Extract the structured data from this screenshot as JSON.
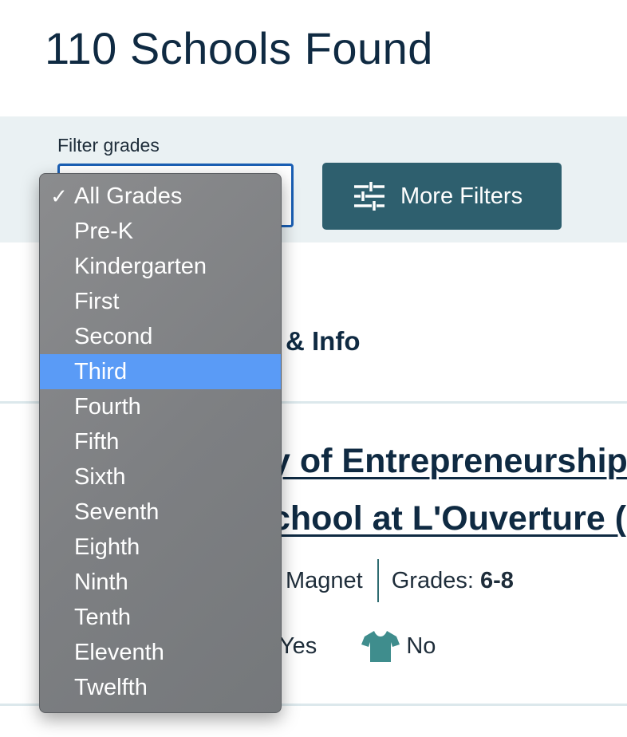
{
  "header": {
    "title": "110 Schools Found"
  },
  "filters": {
    "grade_label": "Filter grades",
    "more_filters_label": "More Filters"
  },
  "results": {
    "section_heading": "& Info",
    "school": {
      "name_line1": "y of Entrepreneurship",
      "name_line2": "chool at L'Ouverture (",
      "type": "Magnet",
      "grades_label": "Grades: ",
      "grades_value": "6-8",
      "feature_value": "Yes",
      "uniform_value": "No"
    }
  },
  "dropdown": {
    "selected_check": "✓",
    "options": [
      "All Grades",
      "Pre-K",
      "Kindergarten",
      "First",
      "Second",
      "Third",
      "Fourth",
      "Fifth",
      "Sixth",
      "Seventh",
      "Eighth",
      "Ninth",
      "Tenth",
      "Eleventh",
      "Twelfth"
    ],
    "selected": "All Grades",
    "highlighted": "Third"
  },
  "colors": {
    "title_text": "#0f2a42",
    "filter_bar_bg": "#eaf1f3",
    "select_border": "#1a5fb4",
    "button_bg": "#2e5f6e",
    "highlight": "#5a9bf6",
    "shirt_icon": "#3f8d8d"
  },
  "icons": {
    "more_filters": "sliders-icon",
    "uniform": "shirt-icon",
    "selected": "checkmark-icon"
  }
}
